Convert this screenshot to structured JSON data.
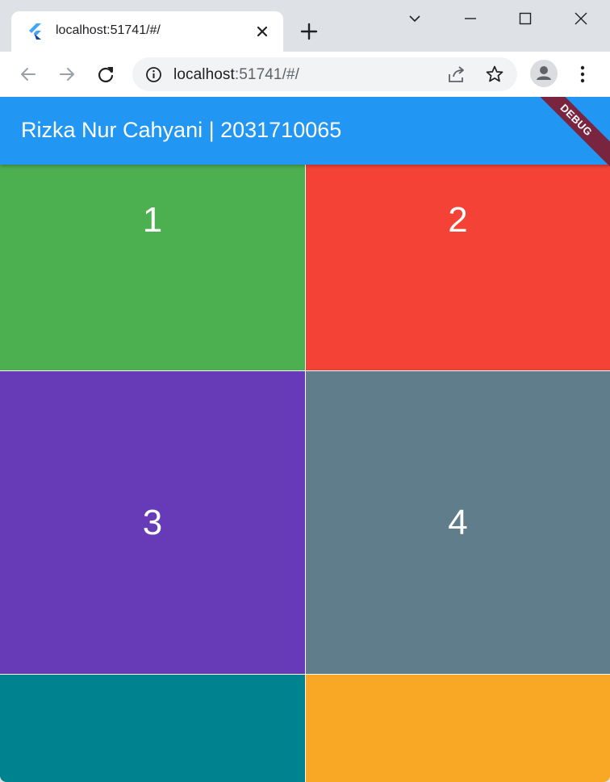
{
  "browser": {
    "tab": {
      "title": "localhost:51741/#/"
    },
    "url": {
      "host": "localhost",
      "rest": ":51741/#/"
    }
  },
  "app": {
    "title": "Rizka Nur Cahyani | 2031710065",
    "debug_label": "DEBUG",
    "appbar_color": "#2196f3",
    "tiles": [
      {
        "label": "1",
        "color": "#4caf50"
      },
      {
        "label": "2",
        "color": "#f44336"
      },
      {
        "label": "3",
        "color": "#673ab7"
      },
      {
        "label": "4",
        "color": "#607d8b"
      },
      {
        "label": "",
        "color": "#00838f"
      },
      {
        "label": "",
        "color": "#f9a825"
      }
    ]
  }
}
